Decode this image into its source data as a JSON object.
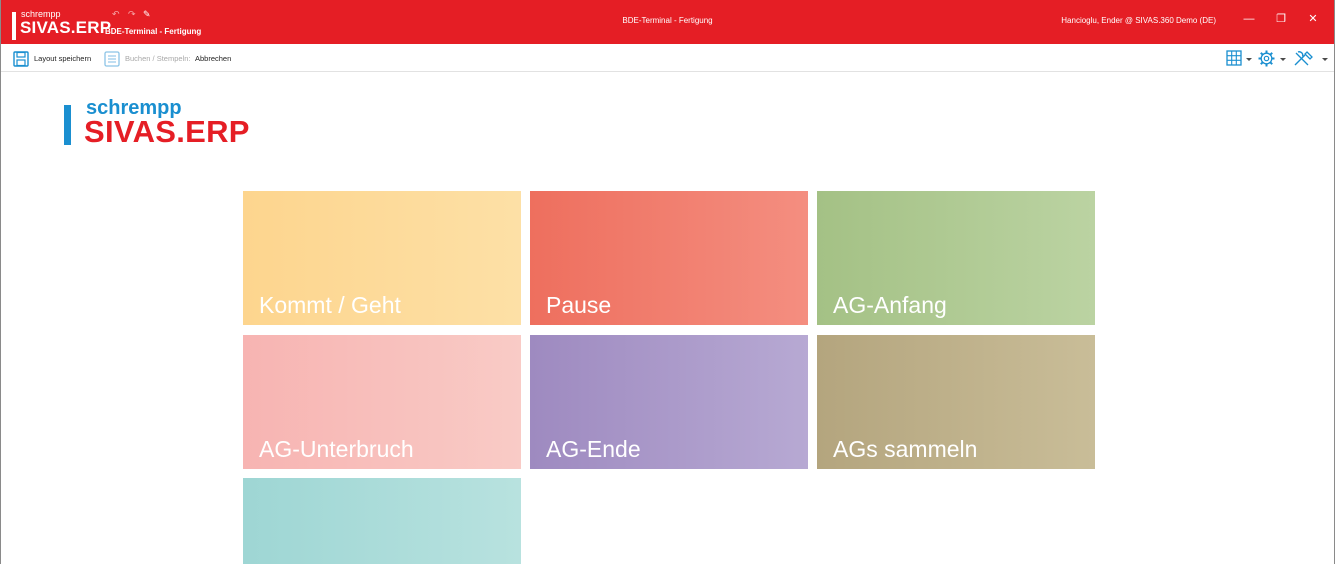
{
  "titlebar": {
    "brand_small": "schrempp",
    "brand_big": "SIVAS.ERP",
    "subtitle": "BDE-Terminal - Fertigung",
    "window_title": "BDE-Terminal - Fertigung",
    "user": "Hancioglu, Ender @ SIVAS.360 Demo (DE)",
    "qa": {
      "undo": "↶",
      "redo": "↷",
      "edit": "✎"
    },
    "controls": {
      "minimize": "—",
      "restore": "❐",
      "close": "✕"
    },
    "color": "#e51e25"
  },
  "toolbar": {
    "save_layout": "Layout speichern",
    "book_stamp": "Buchen / Stempeln:",
    "cancel": "Abbrechen",
    "right_icons": [
      "grid-icon",
      "gear-icon",
      "tools-icon"
    ]
  },
  "logo": {
    "small": "schrempp",
    "big": "SIVAS.ERP",
    "colors": {
      "blue": "#1a8fd0",
      "red": "#e51e25"
    }
  },
  "tiles": [
    {
      "label": "Kommt / Geht",
      "color_from": "#fdd58e",
      "color_to": "#fde0a6"
    },
    {
      "label": "Pause",
      "color_from": "#ee6f5e",
      "color_to": "#f48e80"
    },
    {
      "label": "AG-Anfang",
      "color_from": "#a4c185",
      "color_to": "#bbd3a2"
    },
    {
      "label": "AG-Unterbruch",
      "color_from": "#f7b4b2",
      "color_to": "#f9cbc6"
    },
    {
      "label": "AG-Ende",
      "color_from": "#9e8ac0",
      "color_to": "#b7a9d3"
    },
    {
      "label": "AGs sammeln",
      "color_from": "#b4a57e",
      "color_to": "#c9bd98"
    },
    {
      "label": "",
      "color_from": "#9ed6d4",
      "color_to": "#b8e2df"
    }
  ]
}
